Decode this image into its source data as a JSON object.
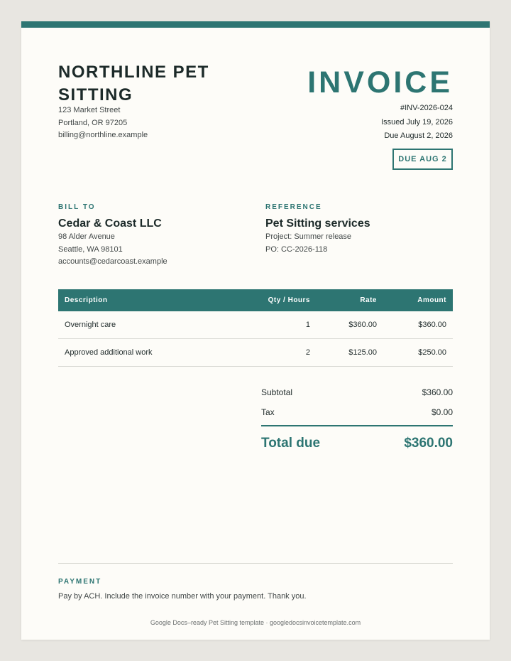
{
  "company": {
    "name": "NORTHLINE PET SITTING",
    "address_lines": [
      "123 Market Street",
      "Portland, OR 97205",
      "billing@northline.example"
    ]
  },
  "invoice": {
    "title": "INVOICE",
    "number": "#INV-2026-024",
    "issued": "Issued July 19, 2026",
    "due": "Due August 2, 2026",
    "due_badge": "DUE AUG 2"
  },
  "bill_to": {
    "label": "BILL TO",
    "name": "Cedar & Coast LLC",
    "lines": [
      "98 Alder Avenue",
      "Seattle, WA 98101",
      "accounts@cedarcoast.example"
    ]
  },
  "reference": {
    "label": "REFERENCE",
    "title": "Pet Sitting services",
    "lines": [
      "Project: Summer release",
      "PO: CC-2026-118"
    ]
  },
  "table": {
    "headers": [
      "Description",
      "Qty / Hours",
      "Rate",
      "Amount"
    ],
    "rows": [
      [
        "Overnight care",
        "1",
        "$360.00",
        "$360.00"
      ],
      [
        "Approved additional work",
        "2",
        "$125.00",
        "$250.00"
      ]
    ]
  },
  "totals": {
    "subtotal_label": "Subtotal",
    "subtotal": "$360.00",
    "tax_label": "Tax",
    "tax": "$0.00",
    "total_label": "Total due",
    "total": "$360.00"
  },
  "payment": {
    "label": "PAYMENT",
    "text": "Pay by ACH. Include the invoice number with your payment. Thank you."
  },
  "footer": {
    "credit": "Google Docs–ready Pet Sitting template · googledocsinvoicetemplate.com"
  },
  "colors": {
    "accent": "#2d7572",
    "page": "#fdfcf8",
    "background": "#e8e6e1"
  }
}
